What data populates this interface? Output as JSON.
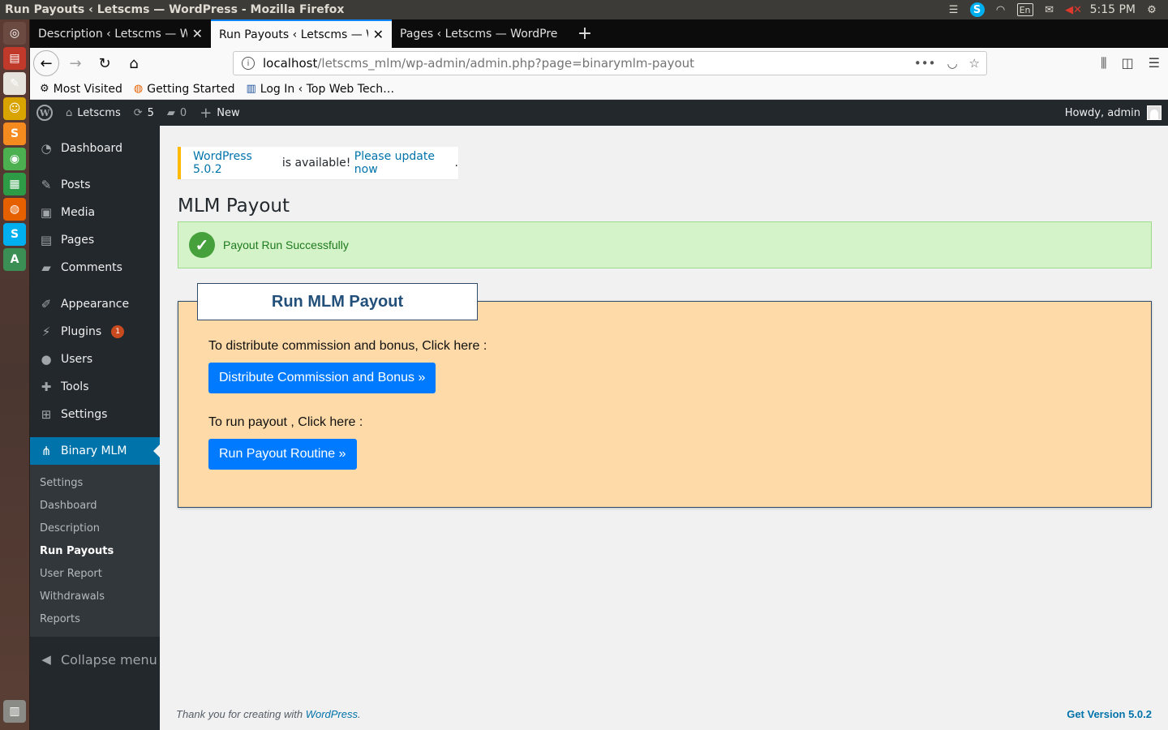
{
  "window": {
    "title": "Run Payouts ‹ Letscms — WordPress - Mozilla Firefox"
  },
  "tray": {
    "keyboard": "En",
    "time": "5:15 PM"
  },
  "launcher": {
    "apps": [
      {
        "name": "dash",
        "glyph": "◎",
        "color": "#6b4a42"
      },
      {
        "name": "files",
        "glyph": "▤",
        "color": "#c0392b"
      },
      {
        "name": "text-editor",
        "glyph": "✎",
        "color": "#e5e3dc"
      },
      {
        "name": "gimp",
        "glyph": "☺",
        "color": "#d9a300"
      },
      {
        "name": "sublime",
        "glyph": "S",
        "color": "#f58b1f"
      },
      {
        "name": "chrome",
        "glyph": "◉",
        "color": "#4caf50"
      },
      {
        "name": "spreadsheet",
        "glyph": "▦",
        "color": "#2e9c46"
      },
      {
        "name": "firefox",
        "glyph": "◍",
        "color": "#e66000"
      },
      {
        "name": "skype",
        "glyph": "S",
        "color": "#00aff0"
      },
      {
        "name": "updater",
        "glyph": "A",
        "color": "#3b8e54"
      }
    ],
    "trash": "▥"
  },
  "tabs": [
    {
      "label": "Description ‹ Letscms — Wo",
      "active": false
    },
    {
      "label": "Run Payouts ‹ Letscms — W",
      "active": true
    },
    {
      "label": "Pages ‹ Letscms — WordPre",
      "active": false
    }
  ],
  "url": {
    "host": "localhost",
    "path": "/letscms_mlm/wp-admin/admin.php?page=binarymlm-payout"
  },
  "bookmarks": [
    {
      "label": "Most Visited",
      "icon": "gear-icon"
    },
    {
      "label": "Getting Started",
      "icon": "firefox-icon"
    },
    {
      "label": "Log In ‹ Top Web Tech…",
      "icon": "site-icon"
    }
  ],
  "adminbar": {
    "site_name": "Letscms",
    "updates_count": "5",
    "comments_count": "0",
    "new_label": "New",
    "howdy": "Howdy, admin"
  },
  "sidebar": {
    "dashboard": "Dashboard",
    "posts": "Posts",
    "media": "Media",
    "pages": "Pages",
    "comments": "Comments",
    "appearance": "Appearance",
    "plugins": "Plugins",
    "plugins_badge": "1",
    "users": "Users",
    "tools": "Tools",
    "settings": "Settings",
    "binary_mlm": "Binary MLM",
    "submenu": {
      "settings": "Settings",
      "dashboard": "Dashboard",
      "description": "Description",
      "run_payouts": "Run Payouts",
      "user_report": "User Report",
      "withdrawals": "Withdrawals",
      "reports": "Reports"
    },
    "collapse": "Collapse menu"
  },
  "notice": {
    "version_link": "WordPress 5.0.2",
    "middle_text": " is available! ",
    "update_link": "Please update now",
    "end": "."
  },
  "page": {
    "title": "MLM Payout",
    "success": "Payout Run Successfully",
    "panel_heading": "Run MLM Payout",
    "distribute_text": "To distribute commission and bonus, Click here :",
    "distribute_button": "Distribute Commission and Bonus »",
    "payout_text": "To run payout , Click here :",
    "payout_button": "Run Payout Routine »"
  },
  "footer": {
    "thanks_prefix": "Thank you for creating with ",
    "thanks_link": "WordPress",
    "thanks_suffix": ".",
    "version": "Get Version 5.0.2"
  }
}
